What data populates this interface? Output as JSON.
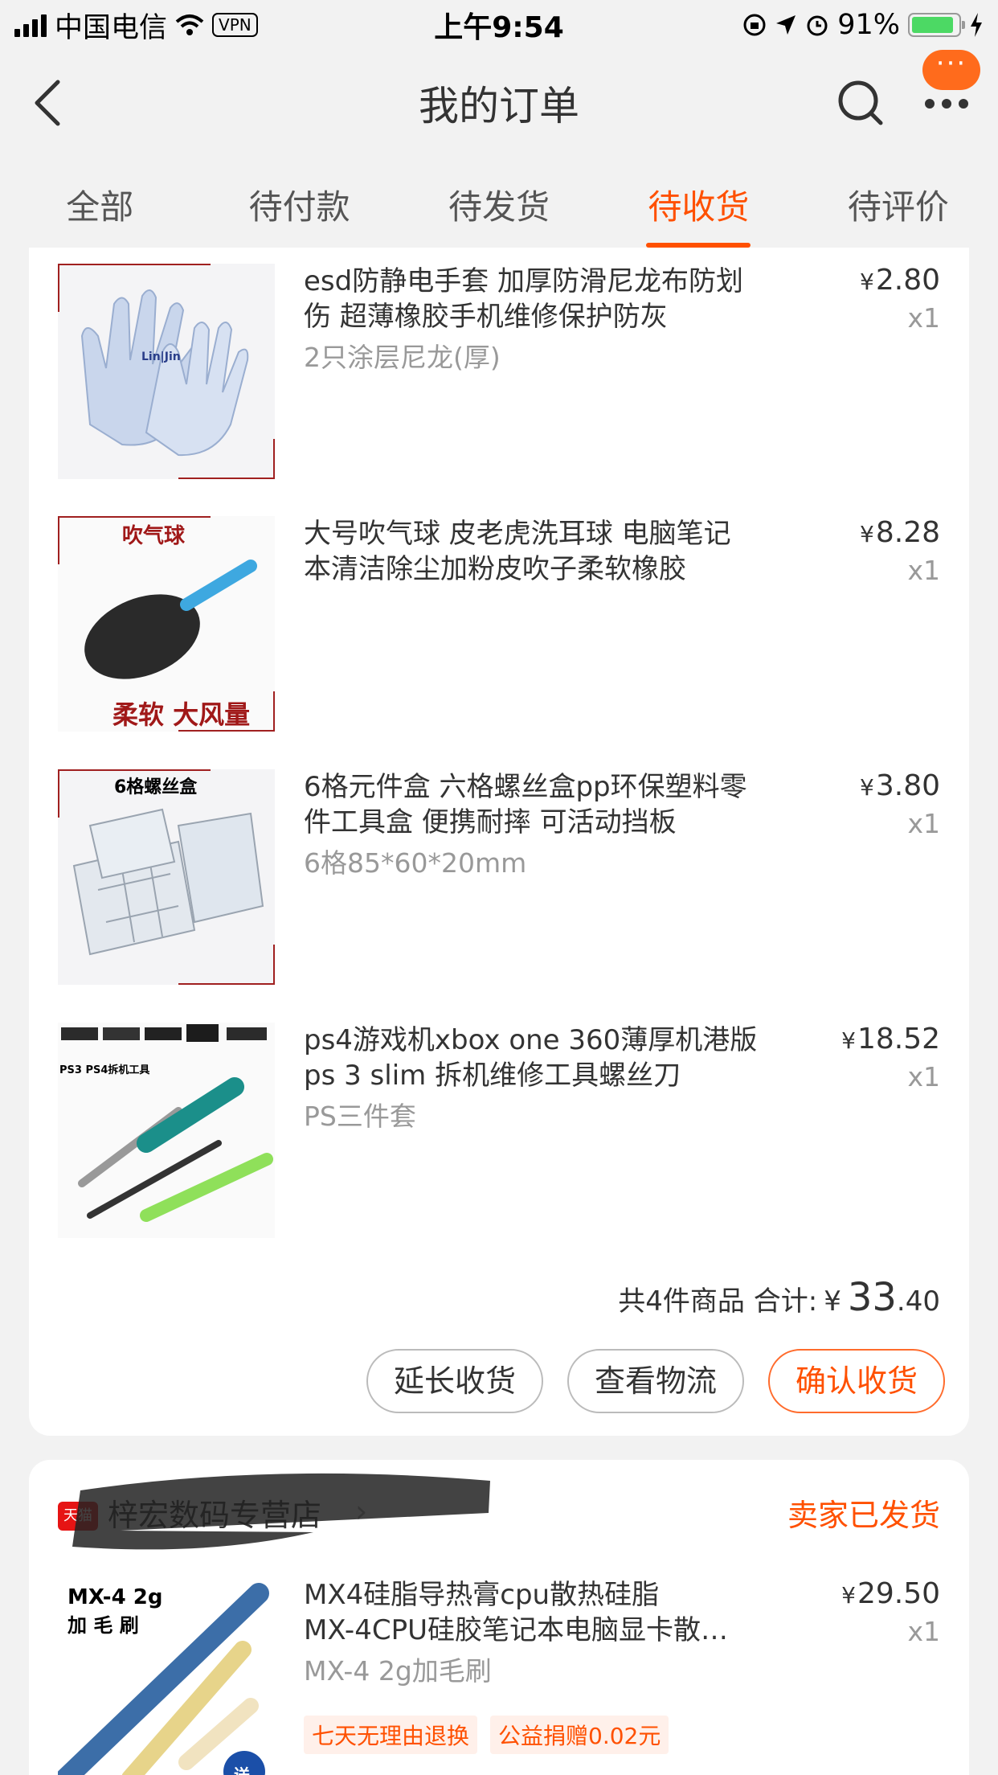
{
  "status_bar": {
    "carrier": "中国电信",
    "vpn": "VPN",
    "time": "上午9:54",
    "battery_percent": "91%",
    "battery_level": 0.91
  },
  "nav": {
    "title": "我的订单",
    "message_badge": "···"
  },
  "tabs": [
    {
      "label": "全部"
    },
    {
      "label": "待付款"
    },
    {
      "label": "待发货"
    },
    {
      "label": "待收货",
      "active": true
    },
    {
      "label": "待评价"
    }
  ],
  "order1": {
    "items": [
      {
        "title_line1": "esd防静电手套 加厚防滑尼龙布防划",
        "title_line2": "伤 超薄橡胶手机维修保护防灰",
        "sku": "2只涂层尼龙(厚)",
        "price": "2.80",
        "qty": "x1",
        "image_text": "Lin|Jin"
      },
      {
        "title_line1": "大号吹气球 皮老虎洗耳球 电脑笔记",
        "title_line2": "本清洁除尘加粉皮吹子柔软橡胶",
        "sku": "",
        "price": "8.28",
        "qty": "x1",
        "image_text_top": "吹气球",
        "image_text_bottom": "柔软  大风量"
      },
      {
        "title_line1": "6格元件盒 六格螺丝盒pp环保塑料零",
        "title_line2": "件工具盒 便携耐摔 可活动挡板",
        "sku": "6格85*60*20mm",
        "price": "3.80",
        "qty": "x1",
        "image_text": "6格螺丝盒"
      },
      {
        "title_line1": "ps4游戏机xbox one 360薄厚机港版",
        "title_line2": "ps 3 slim 拆机维修工具螺丝刀",
        "sku": "PS三件套",
        "price": "18.52",
        "qty": "x1",
        "image_text": "PS3 PS4拆机工具"
      }
    ],
    "total_prefix": "共4件商品 合计:",
    "currency": "¥",
    "total_integer": "33",
    "total_decimal": ".40",
    "buttons": {
      "extend": "延长收货",
      "logistics": "查看物流",
      "confirm": "确认收货"
    }
  },
  "order2": {
    "shop_icon_text": "天猫",
    "shop_name": "梓宏数码专营店",
    "shop_arrow": "›",
    "status": "卖家已发货",
    "item": {
      "title_line1": "MX4硅脂导热膏cpu散热硅脂",
      "title_line2": "MX-4CPU硅胶笔记本电脑显卡散…",
      "sku": "MX-4 2g加毛刷",
      "price": "29.50",
      "qty": "x1",
      "image_text_line1": "MX-4 2g",
      "image_text_line2": "加 毛 刷",
      "image_badge": "送"
    },
    "badges": [
      "七天无理由退换",
      "公益捐赠0.02元"
    ]
  },
  "colors": {
    "accent": "#ff5000",
    "background": "#f2f2f2",
    "card": "#ffffff"
  }
}
